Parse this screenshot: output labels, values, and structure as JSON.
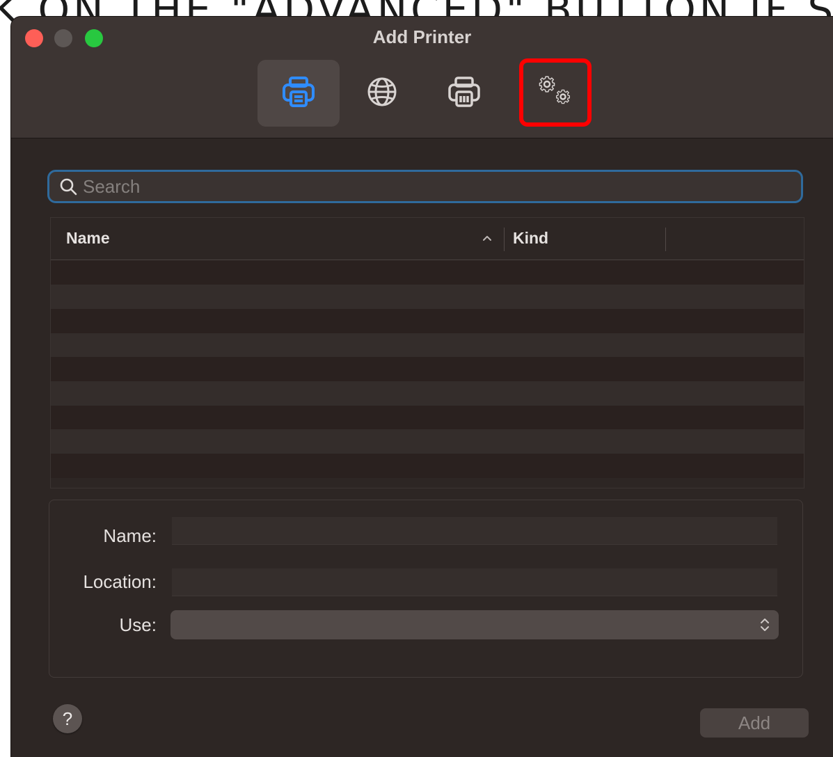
{
  "overlay": {
    "banner_text": "K ON THE \"ADVANCED\" BUTTON IF SHOWN"
  },
  "window": {
    "title": "Add Printer",
    "toolbar": {
      "buttons": [
        {
          "name": "default",
          "icon": "printer-icon",
          "selected": true
        },
        {
          "name": "ip",
          "icon": "globe-icon",
          "selected": false
        },
        {
          "name": "windows",
          "icon": "printer-box-icon",
          "selected": false
        },
        {
          "name": "advanced",
          "icon": "gears-icon",
          "selected": false,
          "highlighted": true
        }
      ],
      "highlight_color": "#ff0000",
      "accent_color": "#2f8cff"
    },
    "search": {
      "placeholder": "Search",
      "value": ""
    },
    "table": {
      "columns": [
        "Name",
        "Kind"
      ],
      "sort_indicator": "^",
      "rows": []
    },
    "form": {
      "name_label": "Name:",
      "name_value": "",
      "location_label": "Location:",
      "location_value": "",
      "use_label": "Use:",
      "use_value": ""
    },
    "footer": {
      "help_label": "?",
      "add_label": "Add"
    }
  }
}
